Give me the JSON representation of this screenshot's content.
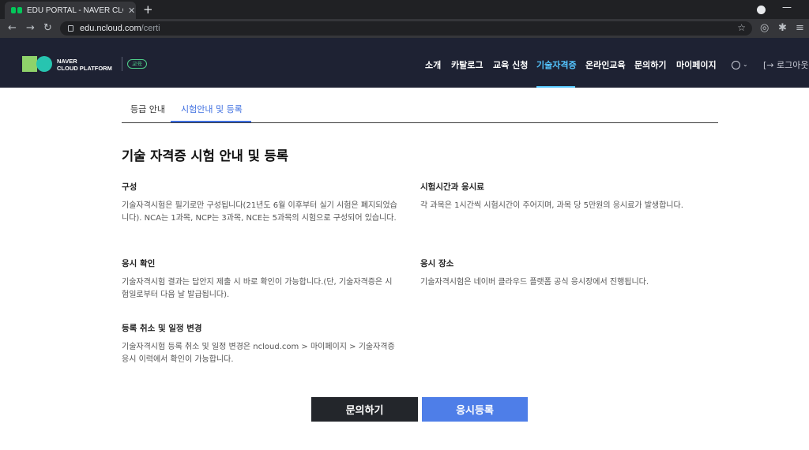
{
  "browser": {
    "tab_title": "EDU PORTAL - NAVER CLOUD P",
    "tab_close": "✕",
    "new_tab": "+",
    "url_host": "edu.ncloud.com",
    "url_path": "/certi",
    "icons": [
      "back-arrow-icon",
      "forward-arrow-icon",
      "reload-icon",
      "lock-icon",
      "star-icon",
      "extensions-icon",
      "menu-icon"
    ]
  },
  "header": {
    "logo_line1": "NAVER",
    "logo_line2": "CLOUD PLATFORM",
    "badge": "교육",
    "nav": [
      "소개",
      "카탈로그",
      "교육 신청",
      "기술자격증",
      "온라인교육",
      "문의하기",
      "마이페이지"
    ],
    "active_nav": "기술자격증",
    "logout": "로그아웃",
    "accent_color": "#54c5ff"
  },
  "subtabs": {
    "items": [
      "등급 안내",
      "시험안내 및 등록"
    ],
    "active": "시험안내 및 등록"
  },
  "page_title": "기술 자격증 시험 안내 및 등록",
  "sections": {
    "composition": {
      "title": "구성",
      "body": "기술자격시험은 필기로만 구성됩니다(21년도 6월 이후부터 실기 시험은 폐지되었습니다). NCA는 1과목, NCP는 3과목, NCE는 5과목의 시험으로 구성되어 있습니다."
    },
    "time_fee": {
      "title": "시험시간과 응시료",
      "body": "각 과목은 1시간씩 시험시간이 주어지며, 과목 당 5만원의 응시료가 발생합니다."
    },
    "confirm": {
      "title": "응시 확인",
      "body": "기술자격시험 결과는 답안지 제출 시 바로 확인이 가능합니다.(단, 기술자격증은 시험일로부터 다음 날 발급됩니다)."
    },
    "place": {
      "title": "응시 장소",
      "body": "기술자격시험은 네이버 클라우드 플랫폼 공식 응시장에서 진행됩니다."
    },
    "cancel": {
      "title": "등록 취소 및 일정 변경",
      "body": "기술자격시험 등록 취소 및 일정 변경은 ncloud.com > 마이페이지 > 기술자격증 응시 이력에서 확인이 가능합니다."
    }
  },
  "buttons": {
    "inquiry": "문의하기",
    "register": "응시등록",
    "register_color": "#4e7ee8"
  }
}
